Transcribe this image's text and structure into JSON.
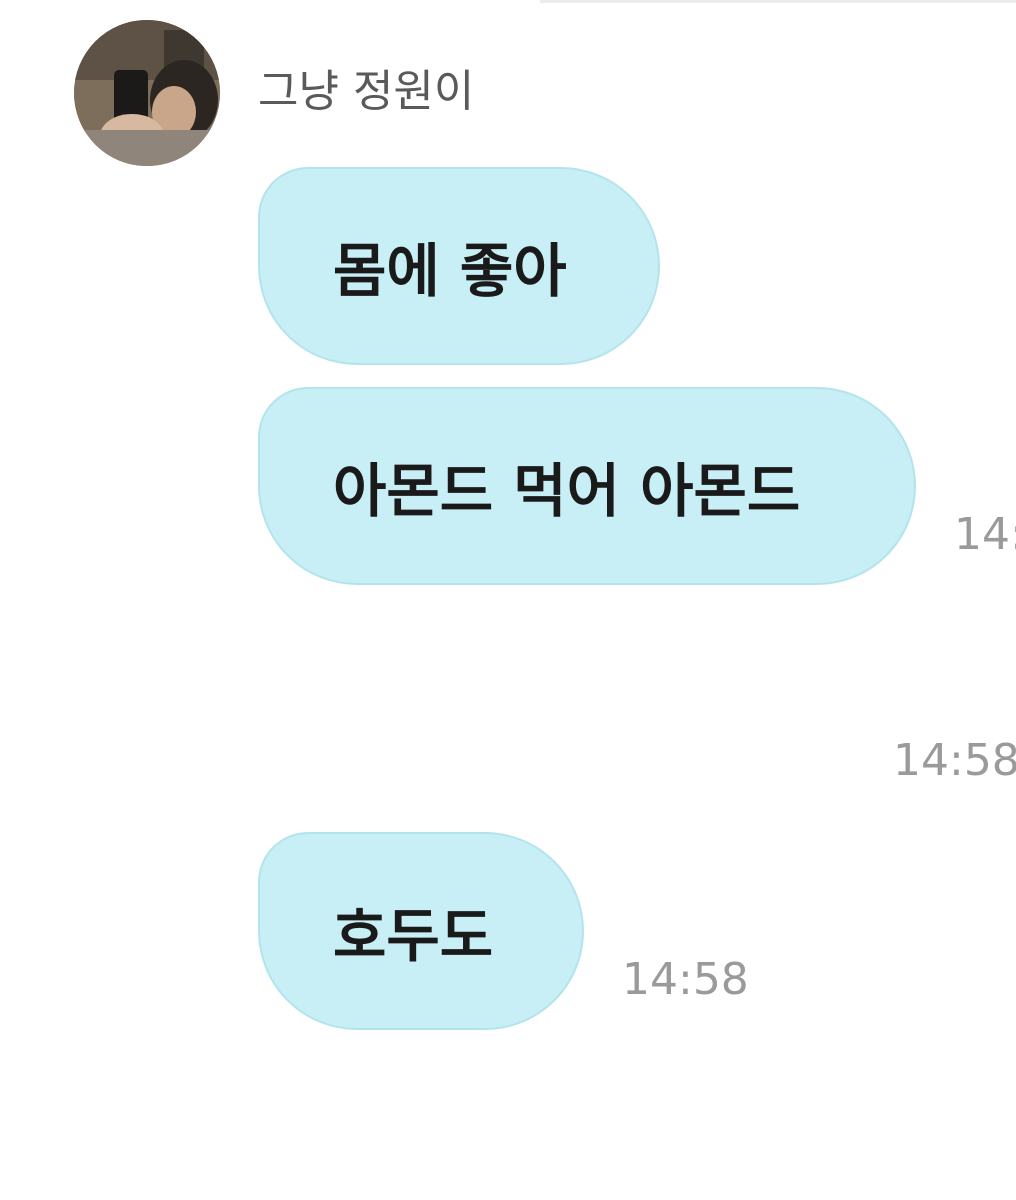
{
  "chat": {
    "sender": {
      "name": "그냥 정원이",
      "avatar": "profile-photo"
    },
    "messages": [
      {
        "text": "몸에 좋아",
        "time": ""
      },
      {
        "text": "아몬드 먹어 아몬드",
        "time": "14:"
      },
      {
        "text": "",
        "time": "14:58"
      },
      {
        "text": "호두도",
        "time": "14:58"
      }
    ]
  },
  "colors": {
    "bubble": "#c7eff5",
    "bubble_border": "#b3e4ec",
    "time": "#9a9a9a",
    "name": "#5a5a5a"
  }
}
